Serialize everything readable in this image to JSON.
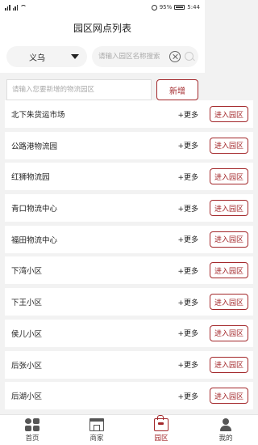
{
  "status": {
    "carrier_icons": "sim-signal-icons",
    "battery_pct": "95%",
    "time": "5:44"
  },
  "header": {
    "title": "园区网点列表"
  },
  "search": {
    "city": "义乌",
    "placeholder": "请输入园区名称搜索"
  },
  "add": {
    "placeholder": "请输入您要新增的物流园区",
    "button": "新增"
  },
  "list": {
    "more_label": "+更多",
    "enter_label": "进入园区",
    "items": [
      "北下朱货运市场",
      "公路港物流园",
      "红狮物流园",
      "青口物流中心",
      "福田物流中心",
      "下湾小区",
      "下王小区",
      "侯儿小区",
      "后张小区",
      "后湖小区"
    ]
  },
  "tabs": [
    {
      "label": "首页",
      "icon": "home-icon",
      "active": false
    },
    {
      "label": "商家",
      "icon": "shop-icon",
      "active": false
    },
    {
      "label": "园区",
      "icon": "park-icon",
      "active": true
    },
    {
      "label": "我的",
      "icon": "mine-icon",
      "active": false
    }
  ],
  "colors": {
    "accent": "#a3282b"
  }
}
